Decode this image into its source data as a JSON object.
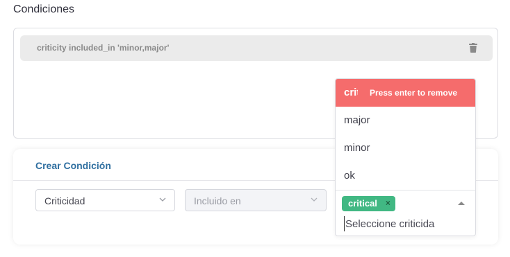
{
  "section": {
    "title": "Condiciones"
  },
  "conditions": [
    {
      "text": "criticity included_in 'minor,major'",
      "delete_icon": "trash-icon"
    }
  ],
  "create": {
    "title": "Crear Condición",
    "field_select": {
      "value": "Criticidad",
      "icon": "chevron-down-icon"
    },
    "operator_select": {
      "value": "Incluido en",
      "disabled": true,
      "icon": "chevron-down-icon"
    }
  },
  "multiselect": {
    "highlighted_option": "critical",
    "highlight_hint": "Press enter to remove",
    "options": [
      "major",
      "minor",
      "ok"
    ],
    "selected_tags": [
      {
        "label": "critical",
        "remove_label": "×"
      }
    ],
    "placeholder": "Seleccione criticida",
    "toggle_icon": "caret-up-icon"
  },
  "colors": {
    "accent_link": "#2f6fa0",
    "tag_green": "#41b883",
    "highlight_red": "#f56c6c"
  }
}
